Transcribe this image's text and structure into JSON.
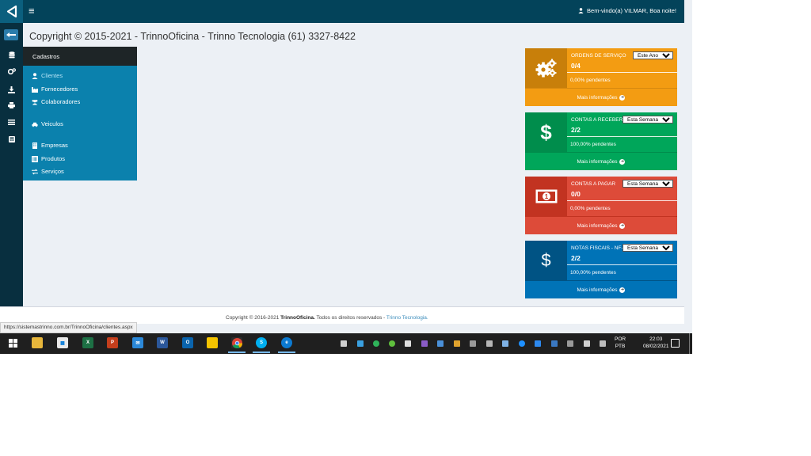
{
  "header": {
    "welcome": "Bem-vindo(a) VILMAR, Boa noite!"
  },
  "page_title": "Copyright © 2015-2021 - TrinnoOficina - Trinno Tecnologia (61) 3327-8422",
  "menu": {
    "title": "Cadastros",
    "items": [
      {
        "label": "Clientes",
        "icon": "user-icon"
      },
      {
        "label": "Fornecedores",
        "icon": "industry-icon"
      },
      {
        "label": "Colaboradores",
        "icon": "users-icon"
      },
      {
        "label": "Veiculos",
        "icon": "car-icon"
      },
      {
        "label": "Empresas",
        "icon": "building-icon"
      },
      {
        "label": "Produtos",
        "icon": "barcode-icon"
      },
      {
        "label": "Serviços",
        "icon": "exchange-icon"
      }
    ]
  },
  "boxes": [
    {
      "title": "ORDENS DE SERVIÇO",
      "count": "0/4",
      "pending": "0,00% pendentes",
      "period": "Este Ano",
      "more": "Mais informações",
      "icon": "gears-icon",
      "color": "#f39c12"
    },
    {
      "title": "CONTAS A RECEBER",
      "count": "2/2",
      "pending": "100,00% pendentes",
      "period": "Esta Semana",
      "more": "Mais informações",
      "icon": "dollar-icon",
      "color": "#00a65a"
    },
    {
      "title": "CONTAS A PAGAR",
      "count": "0/0",
      "pending": "0,00% pendentes",
      "period": "Esta Semana",
      "more": "Mais informações",
      "icon": "money-bill-icon",
      "color": "#dd4b39"
    },
    {
      "title": "NOTAS FISCAIS - NF-E",
      "count": "2/2",
      "pending": "100,00% pendentes",
      "period": "Esta Semana",
      "more": "Mais informações",
      "icon": "dollar-icon",
      "color": "#0073b7"
    }
  ],
  "footer": {
    "prefix": "Copyright © 2016-2021 ",
    "brand": "TrinnoOficina.",
    "middle": " Todos os direitos reservados - ",
    "company": "Trinno Tecnologia."
  },
  "status_url": "https://sistemastrinno.com.br/TrinnoOficina/clientes.aspx",
  "taskbar": {
    "lang_top": "POR",
    "lang_bottom": "PTB",
    "time": "22:03",
    "date": "08/02/2021"
  }
}
